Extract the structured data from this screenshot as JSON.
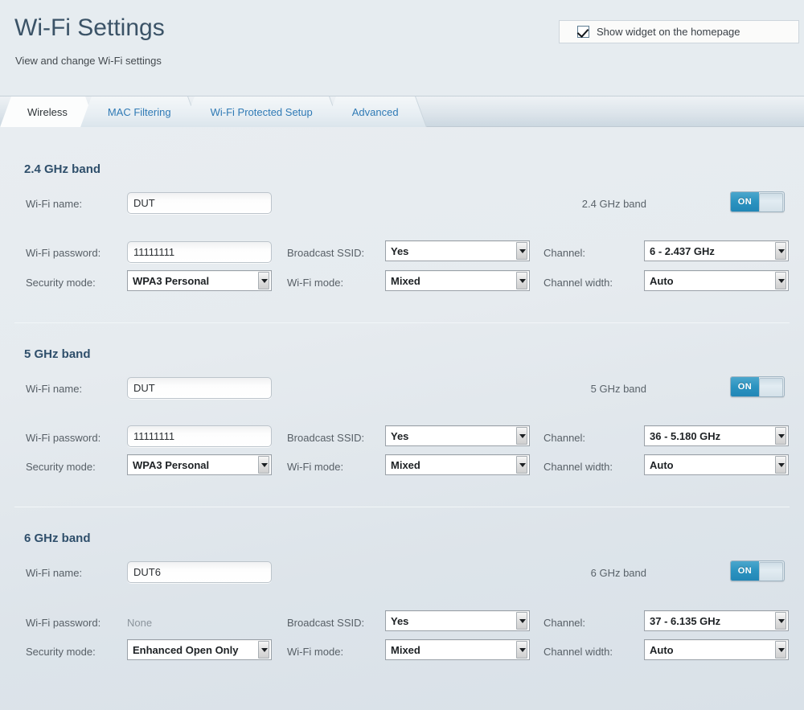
{
  "header": {
    "title": "Wi-Fi Settings",
    "subtitle": "View and change Wi-Fi settings",
    "widget_checkbox_label": "Show widget on the homepage",
    "widget_checkbox_checked": "true"
  },
  "tabs": [
    {
      "label": "Wireless",
      "active": "true"
    },
    {
      "label": "MAC Filtering",
      "active": "false"
    },
    {
      "label": "Wi-Fi Protected Setup",
      "active": "false"
    },
    {
      "label": "Advanced",
      "active": "false"
    }
  ],
  "labels": {
    "wifi_name": "Wi-Fi name:",
    "wifi_password": "Wi-Fi password:",
    "security_mode": "Security mode:",
    "broadcast_ssid": "Broadcast SSID:",
    "wifi_mode": "Wi-Fi mode:",
    "channel": "Channel:",
    "channel_width": "Channel width:"
  },
  "toggle": {
    "on_text": "ON"
  },
  "bands": [
    {
      "title": "2.4 GHz band",
      "toggle_label": "2.4 GHz band",
      "toggle_state": "ON",
      "wifi_name": "DUT",
      "wifi_password": "11111111",
      "password_is_static": "false",
      "security_mode": "WPA3 Personal",
      "broadcast_ssid": "Yes",
      "wifi_mode": "Mixed",
      "channel": "6 - 2.437 GHz",
      "channel_width": "Auto"
    },
    {
      "title": "5 GHz band",
      "toggle_label": "5 GHz band",
      "toggle_state": "ON",
      "wifi_name": "DUT",
      "wifi_password": "11111111",
      "password_is_static": "false",
      "security_mode": "WPA3 Personal",
      "broadcast_ssid": "Yes",
      "wifi_mode": "Mixed",
      "channel": "36 - 5.180 GHz",
      "channel_width": "Auto"
    },
    {
      "title": "6 GHz band",
      "toggle_label": "6 GHz band",
      "toggle_state": "ON",
      "wifi_name": "DUT6",
      "wifi_password": "None",
      "password_is_static": "true",
      "security_mode": "Enhanced Open Only",
      "broadcast_ssid": "Yes",
      "wifi_mode": "Mixed",
      "channel": "37 - 6.135 GHz",
      "channel_width": "Auto"
    }
  ],
  "colors": {
    "accent": "#2b93c0",
    "title": "#3b5367",
    "band_title": "#2f4f6b",
    "tab_link": "#2f7ab5",
    "page_bg": "#e8edf1"
  }
}
